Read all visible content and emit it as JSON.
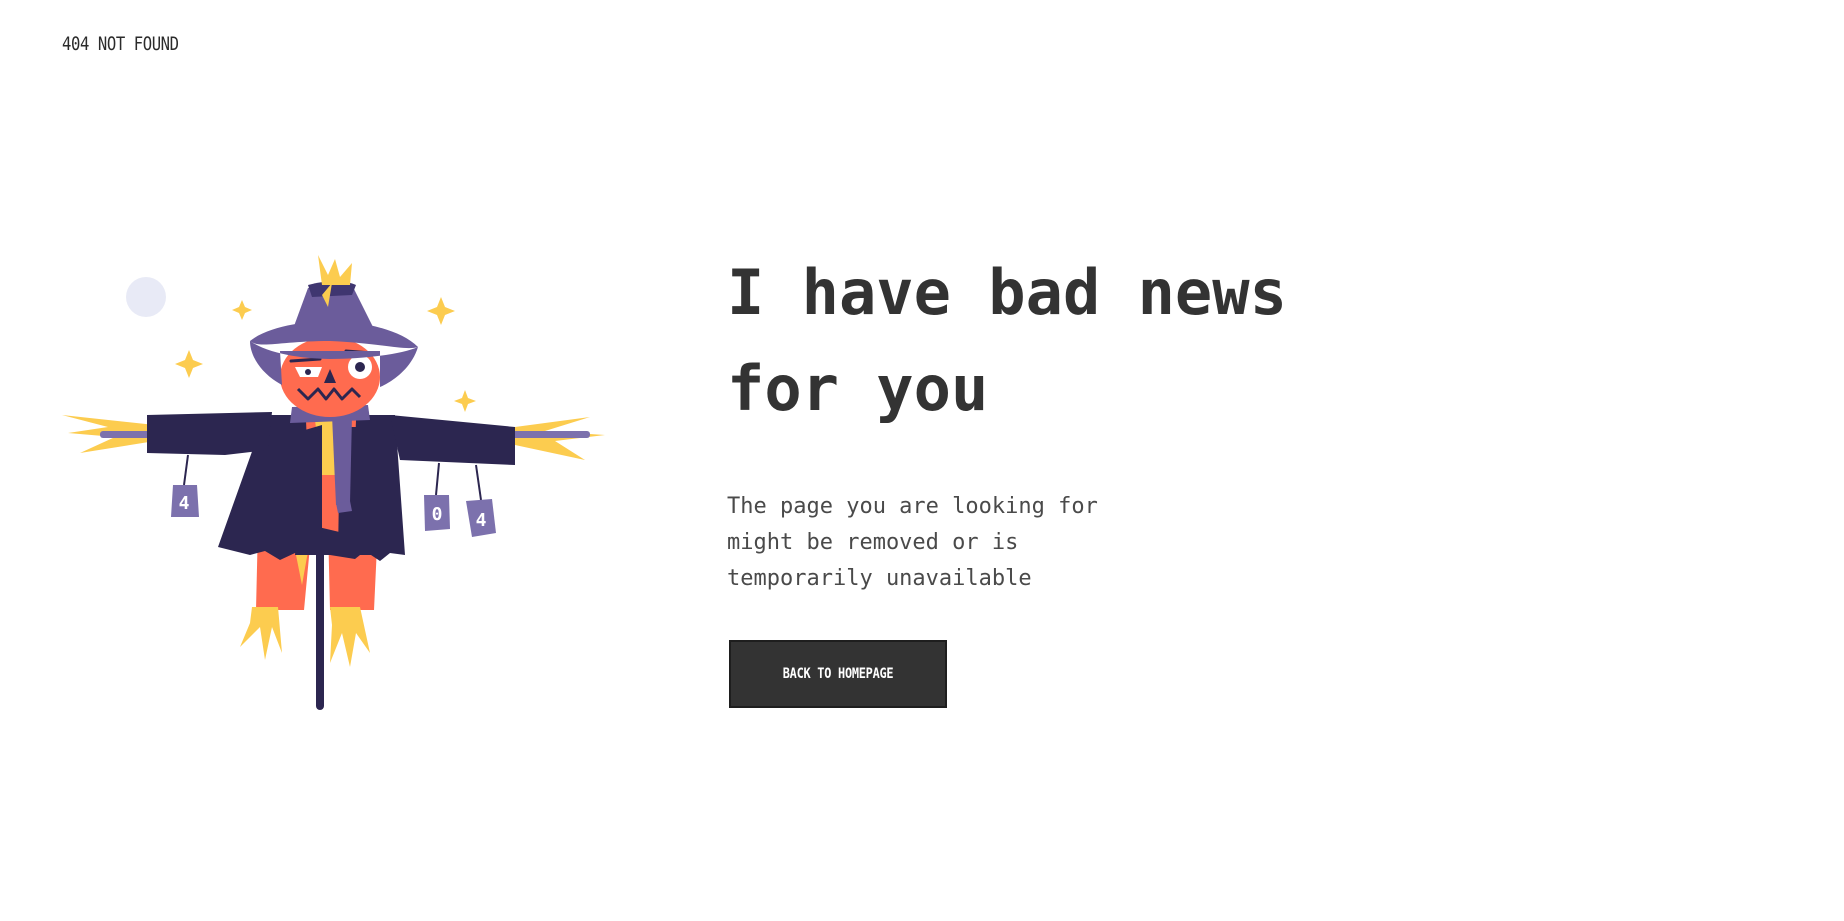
{
  "header": {
    "brand": "404 NOT FOUND"
  },
  "illustration": {
    "name": "scarecrow",
    "can_labels": [
      "4",
      "0",
      "4"
    ]
  },
  "main": {
    "headline_line1": "I have bad news",
    "headline_line2": "for you",
    "description_line1": "The page you are looking for",
    "description_line2": "might be removed or is",
    "description_line3": "temporarily unavailable",
    "button_label": "BACK TO HOMEPAGE"
  },
  "colors": {
    "text_dark": "#333333",
    "button_bg": "#333333",
    "hat": "#6b5c9b",
    "coat": "#2c2650",
    "pumpkin": "#ff6b4f",
    "straw": "#fccc4f",
    "cans": "#7c71ad",
    "moon": "#e8eaf6"
  }
}
